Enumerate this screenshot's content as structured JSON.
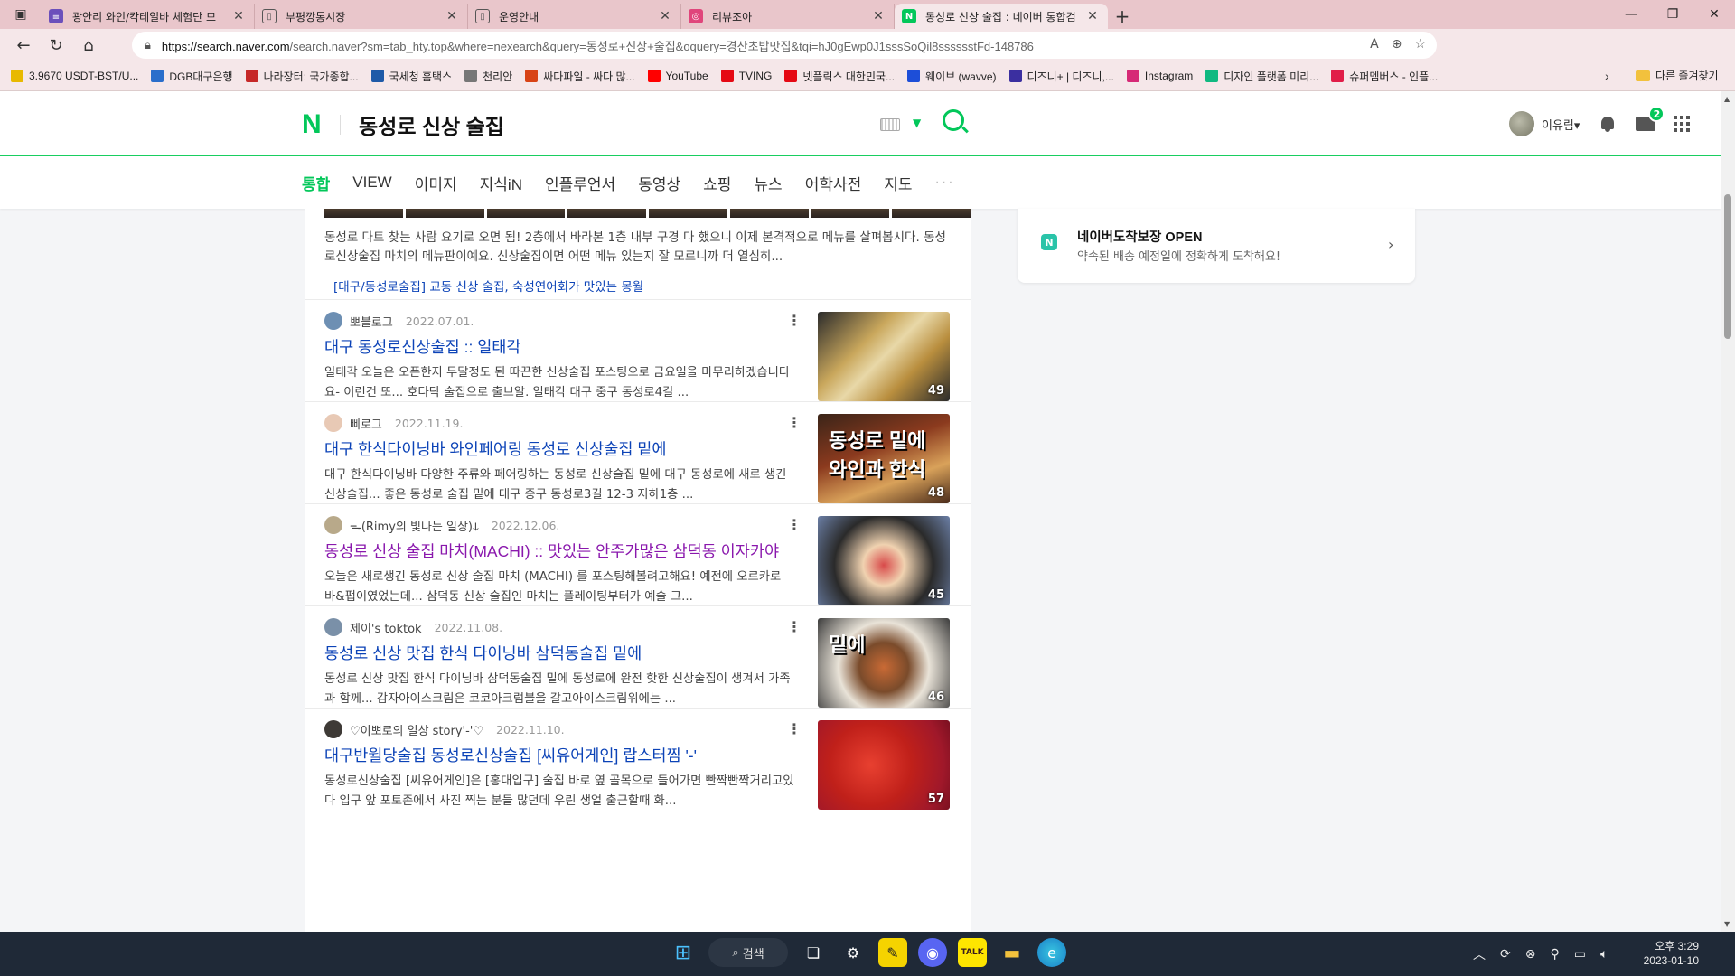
{
  "browser": {
    "tabs": [
      {
        "title": "광안리 와인/칵테일바 체험단 모",
        "icon_color": "#6b4fbb"
      },
      {
        "title": "부평깡통시장",
        "icon_color": "#888888"
      },
      {
        "title": "운영안내",
        "icon_color": "#888888"
      },
      {
        "title": "리뷰조아",
        "icon_color": "#e0457b"
      },
      {
        "title": "동성로 신상 술집 : 네이버 통합검",
        "icon_color": "#03c75a"
      }
    ],
    "url_host": "https://search.naver.com",
    "url_rest": "/search.naver?sm=tab_hty.top&where=nexearch&query=동성로+신상+술집&oquery=경산초밥맛집&tqi=hJ0gEwp0J1sssSoQil8sssssstFd-148786",
    "bookmarks": [
      {
        "label": "3.9670 USDT-BST/U...",
        "color": "#e8b900"
      },
      {
        "label": "DGB대구은행",
        "color": "#2a6ecb"
      },
      {
        "label": "나라장터: 국가종합...",
        "color": "#c62828"
      },
      {
        "label": "국세청 홈택스",
        "color": "#1e5aa8"
      },
      {
        "label": "천리안",
        "color": "#777777"
      },
      {
        "label": "싸다파일 - 싸다 많...",
        "color": "#d84315"
      },
      {
        "label": "YouTube",
        "color": "#ff0000"
      },
      {
        "label": "TVING",
        "color": "#e50914"
      },
      {
        "label": "넷플릭스 대한민국...",
        "color": "#e50914"
      },
      {
        "label": "웨이브 (wavve)",
        "color": "#1d4ed8"
      },
      {
        "label": "디즈니+ | 디즈니,...",
        "color": "#3b2fa0"
      },
      {
        "label": "Instagram",
        "color": "#d62976"
      },
      {
        "label": "디자인 플랫폼 미리...",
        "color": "#10b981"
      },
      {
        "label": "슈퍼멤버스 - 인플...",
        "color": "#e11d48"
      }
    ],
    "other_bookmarks": "다른 즐겨찾기"
  },
  "naver": {
    "logo": "N",
    "query": "동성로 신상 술집",
    "user_name": "이유림",
    "mail_count": "2",
    "tabs": [
      "통합",
      "VIEW",
      "이미지",
      "지식iN",
      "인플루언서",
      "동영상",
      "쇼핑",
      "뉴스",
      "어학사전",
      "지도"
    ],
    "more_tabs": "···"
  },
  "top_item": {
    "desc": "동성로 다트 찾는 사람 요기로 오면 됨! 2층에서 바라본 1층 내부 구경 다 했으니 이제 본격적으로 메뉴를 살펴봅시다. 동성로신상술집 마치의 메뉴판이예요. 신상술집이면 어떤 메뉴 있는지 잘 모르니까 더 열심히...",
    "link": "[대구/동성로술집] 교동 신상 술집, 숙성연어회가 맛있는 몽월"
  },
  "results": [
    {
      "author": "뽀블로그",
      "date": "2022.07.01.",
      "title": "대구 동성로신상술집 :: 일태각",
      "desc": "일태각 오늘은 오픈한지 두달정도 된 따끈한 신상술집 포스팅으로 금요일을 마무리하겠습니다요- 이런건 또... 호다닥 술집으로 출브알. 일태각 대구 중구 동성로4길 ...",
      "count": "49",
      "visited": false
    },
    {
      "author": "삐로그",
      "date": "2022.11.19.",
      "title": "대구 한식다이닝바 와인페어링 동성로 신상술집 밑에",
      "desc": "대구 한식다이닝바 다양한 주류와 페어링하는 동성로 신상술집 밑에 대구 동성로에 새로 생긴 신상술집... 좋은 동성로 술집 밑에 대구 중구 동성로3길 12-3 지하1층 ...",
      "count": "48",
      "overlay": "동성로 밑에\n와인과 한식",
      "visited": false
    },
    {
      "author": "ᯓ(Rimy의 빛나는 일상)ↆ",
      "date": "2022.12.06.",
      "title": "동성로 신상 술집 마치(MACHI) :: 맛있는 안주가많은 삼덕동 이자카야",
      "desc": "오늘은 새로생긴 동성로 신상 술집 마치 (MACHI) 를 포스팅해볼려고해요! 예전에 오르카로 바&펍이였었는데... 삼덕동 신상 술집인 마치는 플레이팅부터가 예술 그...",
      "count": "45",
      "visited": true
    },
    {
      "author": "제이's toktok",
      "date": "2022.11.08.",
      "title": "동성로 신상 맛집 한식 다이닝바 삼덕동술집 밑에",
      "desc": "동성로 신상 맛집 한식 다이닝바 삼덕동술집 밑에 동성로에 완전 핫한 신상술집이 생겨서 가족과 함께... 감자아이스크림은 코코아크럼블을 갈고아이스크림위에는 ...",
      "count": "46",
      "overlay": "밑에",
      "visited": false
    },
    {
      "author": "♡이뽀로의 일상 story'-'♡",
      "date": "2022.11.10.",
      "title": "대구반월당술집 동성로신상술집 [씨유어게인] 랍스터찜 '-'",
      "desc": "동성로신상술집 [씨유어게인]은 [홍대입구] 술집 바로 옆 골목으로 들어가면 빤짝빤짝거리고있다 입구 앞 포토존에서 사진 찍는 분들 많던데 우린 생얼 출근할때 화...",
      "count": "57",
      "visited": false
    }
  ],
  "side": {
    "title": "네이버도착보장 OPEN",
    "desc": "약속된 배송 예정일에 정확하게 도착해요!"
  },
  "taskbar": {
    "search_label": "검색",
    "time": "오후 3:29",
    "date": "2023-01-10"
  }
}
